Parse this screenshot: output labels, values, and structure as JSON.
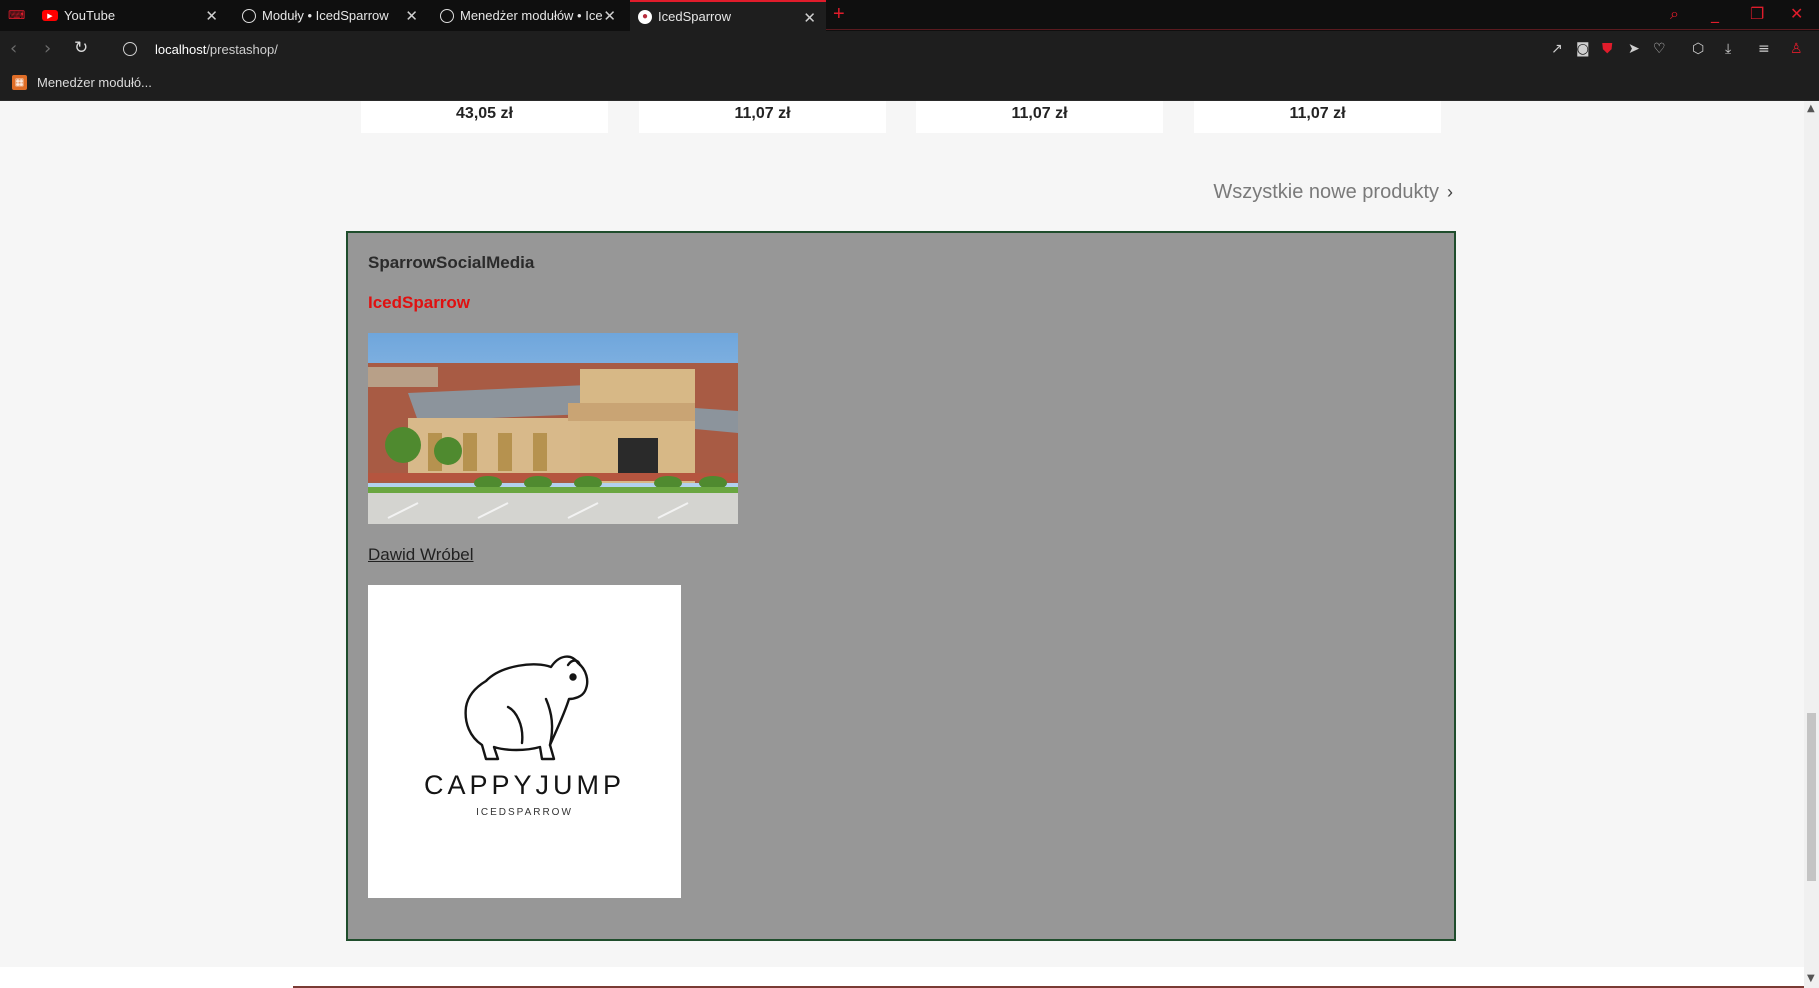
{
  "browser": {
    "tabs": [
      {
        "title": "YouTube",
        "favicon": "youtube-icon"
      },
      {
        "title": "Moduły • IcedSparrow",
        "favicon": "globe-icon"
      },
      {
        "title": "Menedżer modułów • IcedS",
        "favicon": "globe-icon"
      },
      {
        "title": "IcedSparrow",
        "favicon": "prestashop-icon",
        "active": true
      }
    ],
    "url_host": "localhost",
    "url_path": "/prestashop/",
    "bookmark": "Menedżer modułó...",
    "accent_color": "#e01c2b"
  },
  "products": {
    "prices": [
      "43,05 zł",
      "11,07 zł",
      "11,07 zł",
      "11,07 zł"
    ],
    "all_link": "Wszystkie nowe produkty"
  },
  "social": {
    "title": "SparrowSocialMedia",
    "brand": "IcedSparrow",
    "author": "Dawid Wróbel",
    "logo_word": "CAPPYJUMP",
    "logo_sub": "ICEDSPARROW",
    "panel_color": "#979797",
    "border_color": "#1f4d2c"
  }
}
